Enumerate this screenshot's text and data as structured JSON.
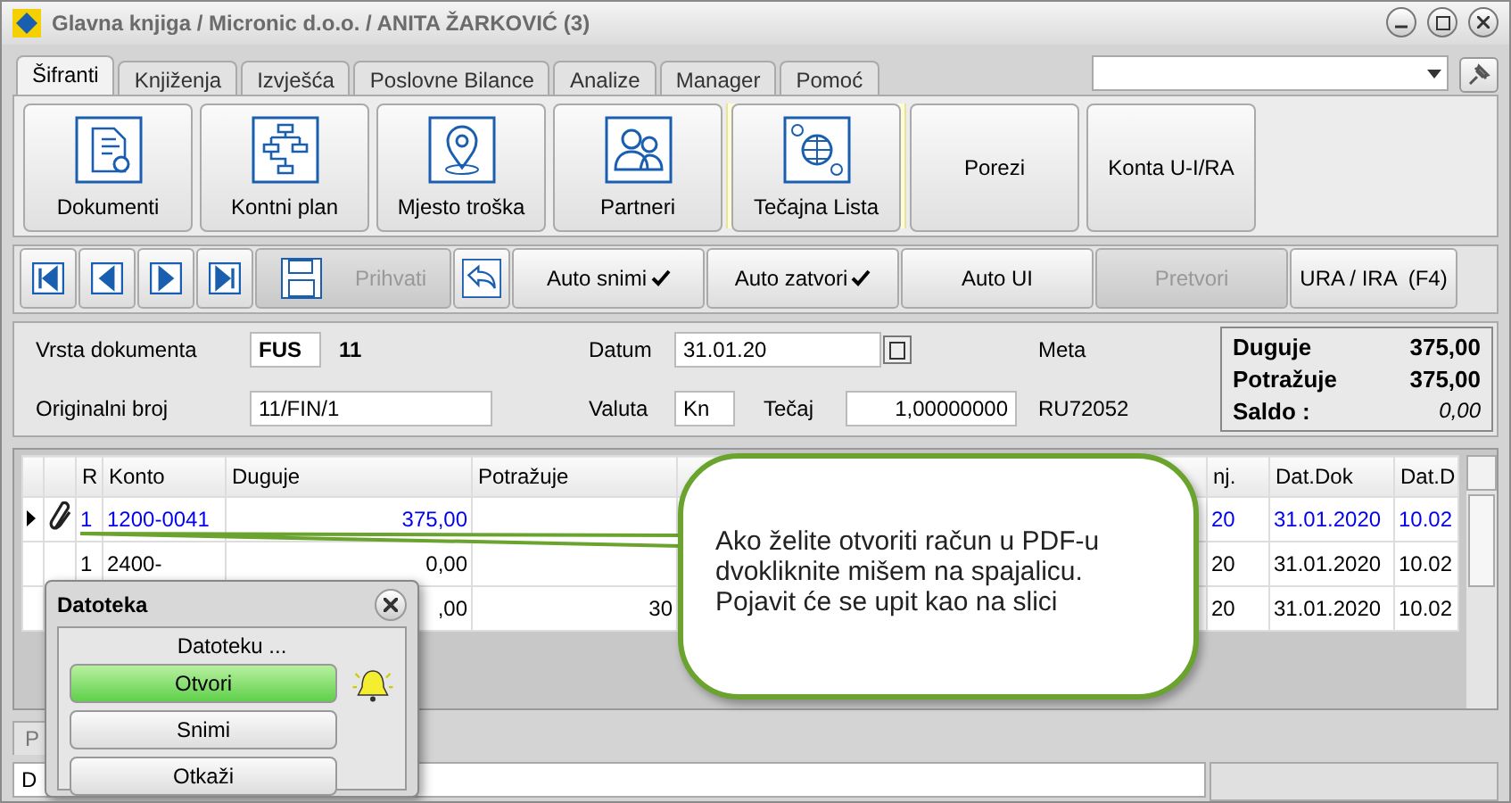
{
  "window": {
    "title": "Glavna knjiga / Micronic d.o.o. / ANITA ŽARKOVIĆ (3)"
  },
  "tabs": [
    {
      "label": "Šifranti",
      "selected": true
    },
    {
      "label": "Knjiženja",
      "selected": false
    },
    {
      "label": "Izvješća",
      "selected": false
    },
    {
      "label": "Poslovne Bilance",
      "selected": false
    },
    {
      "label": "Analize",
      "selected": false
    },
    {
      "label": "Manager",
      "selected": false
    },
    {
      "label": "Pomoć",
      "selected": false
    }
  ],
  "ribbon": [
    {
      "label": "Dokumenti",
      "kind": "icon",
      "selected": false
    },
    {
      "label": "Kontni plan",
      "kind": "icon",
      "selected": false
    },
    {
      "label": "Mjesto troška",
      "kind": "icon",
      "selected": false
    },
    {
      "label": "Partneri",
      "kind": "icon",
      "selected": false
    },
    {
      "label": "Tečajna Lista",
      "kind": "icon",
      "selected": true
    },
    {
      "label": "Porezi",
      "kind": "text",
      "selected": false
    },
    {
      "label": "Konta U-I/RA",
      "kind": "text",
      "selected": false
    }
  ],
  "nav_buttons": [
    {
      "kind": "first"
    },
    {
      "kind": "prev"
    },
    {
      "kind": "next"
    },
    {
      "kind": "last"
    }
  ],
  "actions": [
    {
      "kind": "save",
      "label": "Prihvati",
      "disabled": true
    },
    {
      "kind": "undo"
    },
    {
      "kind": "toggle",
      "label": "Auto snimi",
      "checked": true
    },
    {
      "kind": "toggle",
      "label": "Auto zatvori",
      "checked": true
    },
    {
      "kind": "toggle",
      "label": "Auto UI",
      "checked": false
    },
    {
      "kind": "plain",
      "label": "Pretvori",
      "disabled": true
    },
    {
      "kind": "plain",
      "label": "URA / IRA  (F4)",
      "disabled": false
    }
  ],
  "form": {
    "vrsta_label": "Vrsta dokumenta",
    "vrsta_code": "FUS",
    "vrsta_number": "11",
    "datum_label": "Datum",
    "datum_value": "31.01.20",
    "meta_label": "Meta",
    "originalni_label": "Originalni broj",
    "originalni_value": "11/FIN/1",
    "valuta_label": "Valuta",
    "valuta_value": "Kn",
    "tecaj_label": "Tečaj",
    "tecaj_value": "1,00000000",
    "reference": "RU72052"
  },
  "summary": [
    {
      "label": "Duguje",
      "value": "375,00"
    },
    {
      "label": "Potražuje",
      "value": "375,00"
    },
    {
      "label": "Saldo  :",
      "value": "0,00"
    }
  ],
  "grid": {
    "columns": [
      "R",
      "Konto",
      "Duguje",
      "Potražuje",
      "nj.",
      "Dat.Dok",
      "Dat.D"
    ],
    "rows": [
      {
        "selected": true,
        "attachment": true,
        "r": "1",
        "konto": "1200-0041",
        "duguje": "375,00",
        "nj": "20",
        "dat_dok": "31.01.2020",
        "dat_d": "10.02"
      },
      {
        "selected": false,
        "attachment": false,
        "r": "1",
        "konto": "2400-",
        "duguje": "0,00",
        "nj": "20",
        "dat_dok": "31.01.2020",
        "dat_d": "10.02"
      },
      {
        "selected": false,
        "duguje": ",00",
        "potrazuje": "30",
        "nj": "20",
        "dat_dok": "31.01.2020",
        "dat_d": "10.02"
      }
    ]
  },
  "bottom_tab": "P",
  "status": "D",
  "dialog": {
    "title": "Datoteka",
    "subtitle": "Datoteku ...",
    "buttons": [
      {
        "label": "Otvori",
        "selected": true
      },
      {
        "label": "Snimi",
        "selected": false
      },
      {
        "label": "Otkaži",
        "selected": false
      }
    ]
  },
  "callout": "Ako želite otvoriti račun u PDF-u\ndvokliknite mišem na spajalicu.\nPojavit će se upit kao na slici"
}
